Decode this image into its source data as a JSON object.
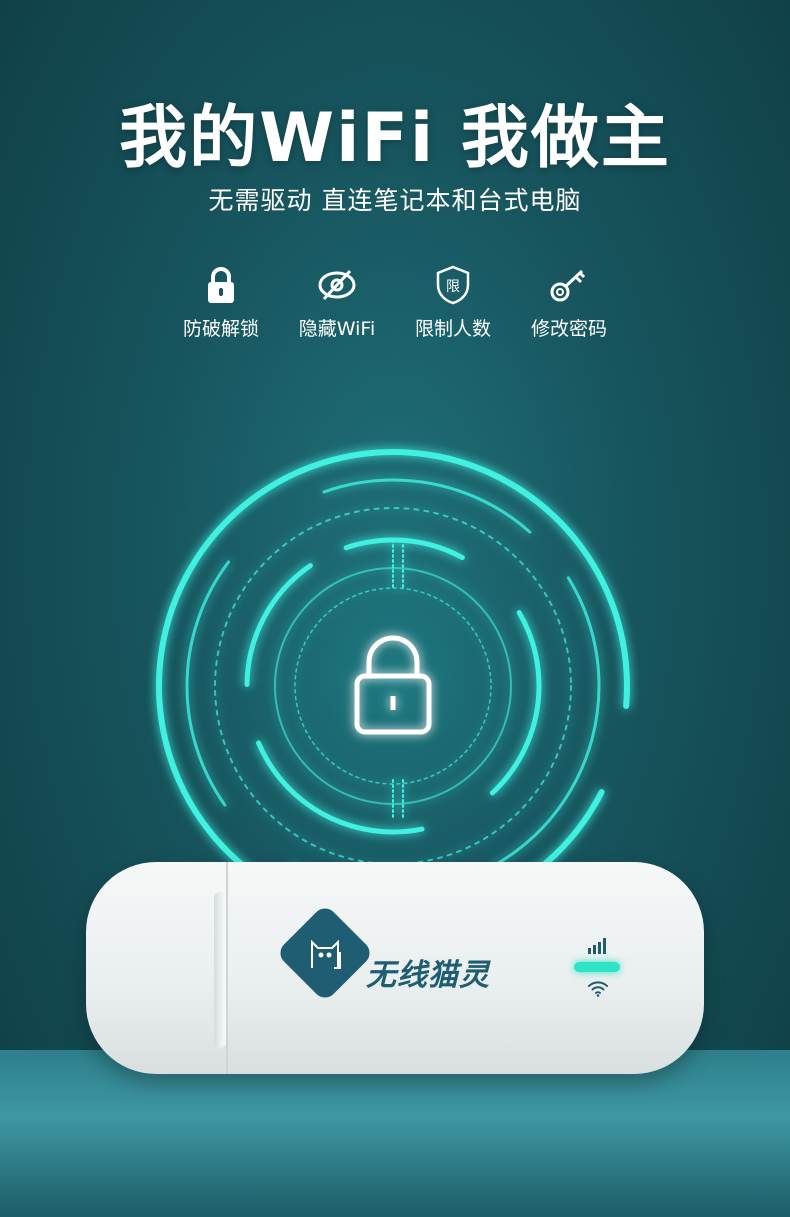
{
  "headline": "我的WiFi 我做主",
  "subheadline": "无需驱动 直连笔记本和台式电脑",
  "features": [
    {
      "icon": "lock-icon",
      "label": "防破解锁"
    },
    {
      "icon": "hidden-eye-icon",
      "label": "隐藏WiFi"
    },
    {
      "icon": "limit-shield-icon",
      "label": "限制人数"
    },
    {
      "icon": "key-icon",
      "label": "修改密码"
    }
  ],
  "shield_badge_text": "限",
  "product": {
    "brand_name": "无线猫灵",
    "logo_icon": "cat-logo-icon",
    "indicator_color": "#2fe3c9"
  },
  "colors": {
    "background": "#17545d",
    "accent_glow": "#3ff0e0",
    "brand": "#1f5e72"
  }
}
